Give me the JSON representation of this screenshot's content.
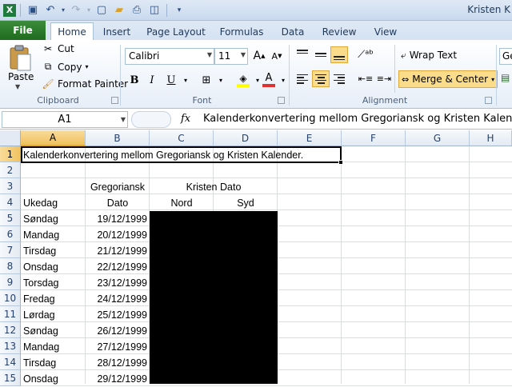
{
  "window": {
    "title": "Kristen K"
  },
  "quick_access": {
    "icons": [
      "excel-icon",
      "save-icon",
      "undo-icon",
      "redo-icon",
      "new-icon",
      "open-icon",
      "print-icon",
      "preview-icon",
      "customize-icon"
    ]
  },
  "tabs": [
    "File",
    "Home",
    "Insert",
    "Page Layout",
    "Formulas",
    "Data",
    "Review",
    "View"
  ],
  "clipboard": {
    "paste": "Paste",
    "cut": "Cut",
    "copy": "Copy",
    "format_painter": "Format Painter",
    "label": "Clipboard"
  },
  "font": {
    "name": "Calibri",
    "size": "11",
    "bold": "B",
    "italic": "I",
    "underline": "U",
    "label": "Font"
  },
  "alignment": {
    "wrap_text": "Wrap Text",
    "merge_center": "Merge & Center",
    "label": "Alignment"
  },
  "number": {
    "format_partial": "Ge"
  },
  "formula_bar": {
    "name_box": "A1",
    "fx": "fx",
    "content": "Kalenderkonvertering mellom Gregoriansk og Kristen Kalender."
  },
  "columns": [
    "A",
    "B",
    "C",
    "D",
    "E",
    "F",
    "G",
    "H"
  ],
  "rows": [
    "1",
    "2",
    "3",
    "4",
    "5",
    "6",
    "7",
    "8",
    "9",
    "10",
    "11",
    "12",
    "13",
    "14",
    "15"
  ],
  "sheet": {
    "a1": "Kalenderkonvertering mellom Gregoriansk og Kristen Kalender.",
    "b3": "Gregoriansk",
    "cd3": "Kristen Dato",
    "a4": "Ukedag",
    "b4": "Dato",
    "c4": "Nord",
    "d4": "Syd",
    "days": [
      "Søndag",
      "Mandag",
      "Tirsdag",
      "Onsdag",
      "Torsdag",
      "Fredag",
      "Lørdag",
      "Søndag",
      "Mandag",
      "Tirsdag",
      "Onsdag"
    ],
    "dates": [
      "19/12/1999",
      "20/12/1999",
      "21/12/1999",
      "22/12/1999",
      "23/12/1999",
      "24/12/1999",
      "25/12/1999",
      "26/12/1999",
      "27/12/1999",
      "28/12/1999",
      "29/12/1999"
    ]
  },
  "colors": {
    "font_color": "#e03030",
    "highlight": "#ffff00",
    "file_tab": "#2e7d32",
    "selection": "#f1c15f"
  }
}
